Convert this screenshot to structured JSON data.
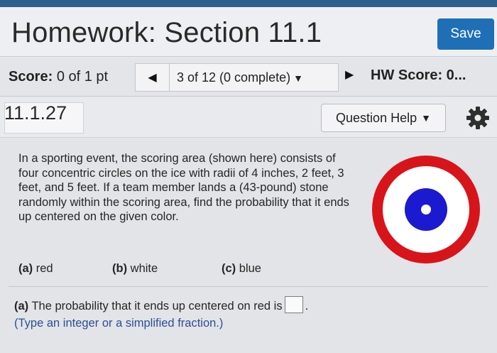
{
  "header": {
    "title": "Homework: Section 11.1",
    "save_label": "Save"
  },
  "nav": {
    "score_prefix": "Score:",
    "score_value": "0 of 1 pt",
    "question_select": "3 of 12 (0 complete)",
    "hw_score": "HW Score: 0..."
  },
  "question": {
    "id": "11.1.27",
    "help_label": "Question Help"
  },
  "problem": {
    "text": "In a sporting event, the scoring area (shown here) consists of four concentric circles on the ice with radii of 4 inches, 2 feet, 3 feet, and 5 feet. If a team member lands a (43-pound) stone randomly within the scoring area, find the probability that it ends up centered on the given color.",
    "parts": [
      {
        "letter": "(a)",
        "label": "red"
      },
      {
        "letter": "(b)",
        "label": "white"
      },
      {
        "letter": "(c)",
        "label": "blue"
      }
    ],
    "answer_prompt_letter": "(a)",
    "answer_prompt": "The probability that it ends up centered on red is",
    "answer_suffix": ".",
    "answer_value": "",
    "hint": "(Type an integer or a simplified fraction.)"
  },
  "icons": {
    "prev": "triangle-left-icon",
    "next": "triangle-right-icon",
    "caret": "caret-down-icon",
    "gear": "gear-icon"
  },
  "colors": {
    "save_button": "#1f6fb7",
    "target_red": "#d8141b",
    "target_white": "#ffffff",
    "target_blue": "#1c1ad0",
    "hint_text": "#2a4f95"
  }
}
